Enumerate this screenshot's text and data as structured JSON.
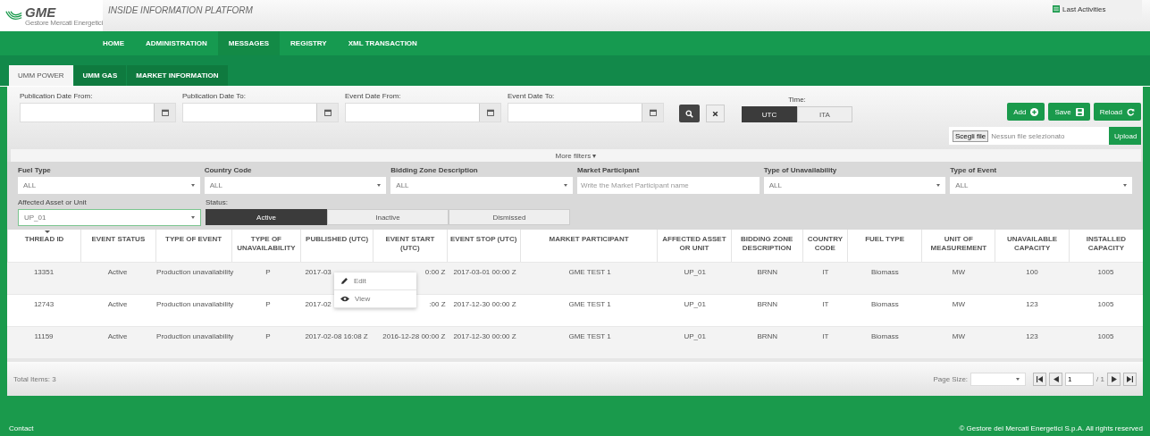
{
  "header": {
    "logo": {
      "name": "GME",
      "subtitle": "Gestore Mercati Energetici"
    },
    "title": "INSIDE INFORMATION PLATFORM",
    "last_activities": "Last Activities"
  },
  "nav": [
    {
      "label": "HOME",
      "selected": false
    },
    {
      "label": "ADMINISTRATION",
      "selected": false
    },
    {
      "label": "MESSAGES",
      "selected": true
    },
    {
      "label": "REGISTRY",
      "selected": false
    },
    {
      "label": "XML TRANSACTION",
      "selected": false
    }
  ],
  "tabs": [
    {
      "label": "UMM POWER",
      "selected": true
    },
    {
      "label": "UMM GAS",
      "selected": false
    },
    {
      "label": "MARKET INFORMATION",
      "selected": false
    }
  ],
  "date_filters": [
    {
      "label": "Publication Date From:"
    },
    {
      "label": "Publication Date To:"
    },
    {
      "label": "Event Date From:"
    },
    {
      "label": "Event Date To:"
    }
  ],
  "time": {
    "label": "Time:",
    "options": [
      {
        "label": "UTC",
        "selected": true
      },
      {
        "label": "ITA",
        "selected": false
      }
    ]
  },
  "actions": [
    {
      "label": "Add",
      "kind": "add"
    },
    {
      "label": "Save",
      "kind": "save"
    },
    {
      "label": "Reload",
      "kind": "reload"
    }
  ],
  "upload": {
    "choose": "Scegli file",
    "status": "Nessun file selezionato",
    "button": "Upload"
  },
  "more_filters": "More filters ▾",
  "filters": [
    {
      "label": "Fuel Type",
      "kind": "select",
      "value": "ALL"
    },
    {
      "label": "Country Code",
      "kind": "select",
      "value": "ALL"
    },
    {
      "label": "Bidding Zone Description",
      "kind": "select",
      "value": "ALL"
    },
    {
      "label": "Market Participant",
      "kind": "text",
      "placeholder": "Write the Market Participant name"
    },
    {
      "label": "Type of Unavailability",
      "kind": "select",
      "value": "ALL"
    },
    {
      "label": "Type of Event",
      "kind": "select",
      "value": "ALL"
    }
  ],
  "asset": {
    "label": "Affected Asset or Unit",
    "value": "UP_01"
  },
  "status": {
    "label": "Status:",
    "options": [
      {
        "label": "Active",
        "selected": true
      },
      {
        "label": "Inactive",
        "selected": false
      },
      {
        "label": "Dismissed",
        "selected": false
      }
    ]
  },
  "table": {
    "columns": [
      "THREAD ID",
      "EVENT STATUS",
      "TYPE OF EVENT",
      "TYPE OF UNAVAILABILITY",
      "PUBLISHED (UTC)",
      "EVENT START (UTC)",
      "EVENT STOP (UTC)",
      "MARKET PARTICIPANT",
      "AFFECTED ASSET OR UNIT",
      "BIDDING ZONE DESCRIPTION",
      "COUNTRY CODE",
      "FUEL TYPE",
      "UNIT OF MEASUREMENT",
      "UNAVAILABLE CAPACITY",
      "INSTALLED CAPACITY"
    ],
    "rows": [
      {
        "cells": [
          "13351",
          "Active",
          "Production unavailability",
          "P",
          "2017-03",
          "0:00 Z",
          "2017-03-01 00:00 Z",
          "GME TEST 1",
          "UP_01",
          "BRNN",
          "IT",
          "Biomass",
          "MW",
          "100",
          "1005"
        ]
      },
      {
        "cells": [
          "12743",
          "Active",
          "Production unavailability",
          "P",
          "2017-02",
          ":00 Z",
          "2017-12-30 00:00 Z",
          "GME TEST 1",
          "UP_01",
          "BRNN",
          "IT",
          "Biomass",
          "MW",
          "123",
          "1005"
        ]
      },
      {
        "cells": [
          "11159",
          "Active",
          "Production unavailability",
          "P",
          "2017-02-08 16:08 Z",
          "2016-12-28 00:00 Z",
          "2017-12-30 00:00 Z",
          "GME TEST 1",
          "UP_01",
          "BRNN",
          "IT",
          "Biomass",
          "MW",
          "123",
          "1005"
        ]
      }
    ]
  },
  "context_menu": [
    {
      "label": "Edit",
      "kind": "edit"
    },
    {
      "label": "View",
      "kind": "view"
    }
  ],
  "footer": {
    "total": "Total Items: 3",
    "page_size": "Page Size:",
    "page": "1",
    "pages": "/ 1"
  },
  "bottom": {
    "contact": "Contact",
    "copyright": "© Gestore dei Mercati Energetici S.p.A. All rights reserved"
  }
}
